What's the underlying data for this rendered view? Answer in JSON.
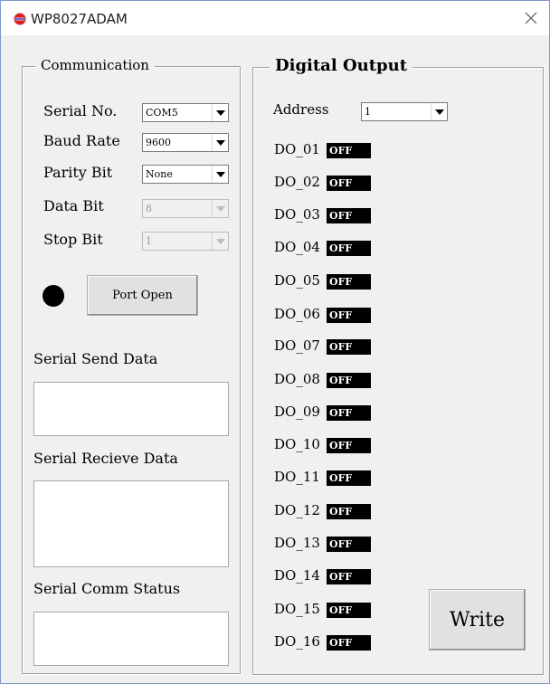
{
  "window": {
    "title": "WP8027ADAM",
    "app_icon": "power-icon",
    "close_icon": "close-icon"
  },
  "communication": {
    "group_label": "Communication",
    "serial_no": {
      "label": "Serial No.",
      "value": "COM5"
    },
    "baud_rate": {
      "label": "Baud Rate",
      "value": "9600"
    },
    "parity_bit": {
      "label": "Parity Bit",
      "value": "None"
    },
    "data_bit": {
      "label": "Data Bit",
      "value": "8"
    },
    "stop_bit": {
      "label": "Stop Bit",
      "value": "1"
    },
    "port_button": "Port Open",
    "send_label": "Serial Send Data",
    "receive_label": "Serial Recieve Data",
    "status_label": "Serial Comm Status"
  },
  "digital_output": {
    "group_label": "Digital Output",
    "address_label": "Address",
    "address_value": "1",
    "write_button": "Write",
    "outputs": [
      {
        "label": "DO_01",
        "state": "OFF"
      },
      {
        "label": "DO_02",
        "state": "OFF"
      },
      {
        "label": "DO_03",
        "state": "OFF"
      },
      {
        "label": "DO_04",
        "state": "OFF"
      },
      {
        "label": "DO_05",
        "state": "OFF"
      },
      {
        "label": "DO_06",
        "state": "OFF"
      },
      {
        "label": "DO_07",
        "state": "OFF"
      },
      {
        "label": "DO_08",
        "state": "OFF"
      },
      {
        "label": "DO_09",
        "state": "OFF"
      },
      {
        "label": "DO_10",
        "state": "OFF"
      },
      {
        "label": "DO_11",
        "state": "OFF"
      },
      {
        "label": "DO_12",
        "state": "OFF"
      },
      {
        "label": "DO_13",
        "state": "OFF"
      },
      {
        "label": "DO_14",
        "state": "OFF"
      },
      {
        "label": "DO_15",
        "state": "OFF"
      },
      {
        "label": "DO_16",
        "state": "OFF"
      }
    ]
  },
  "colors": {
    "window_bg": "#f0f0f0",
    "led_off": "#000000",
    "badge_bg": "#000000",
    "badge_text": "#ffffff"
  }
}
